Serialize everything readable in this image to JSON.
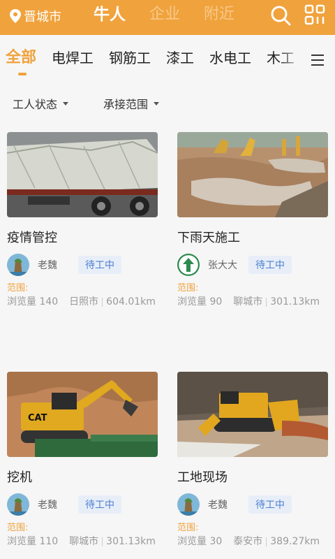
{
  "header": {
    "location": "晋城市",
    "tabs": [
      {
        "label": "牛人",
        "active": true
      },
      {
        "label": "企业",
        "active": false
      },
      {
        "label": "附近",
        "active": false
      }
    ],
    "accent_color": "#f0a23c"
  },
  "categories": [
    {
      "label": "全部",
      "active": true
    },
    {
      "label": "电焊工"
    },
    {
      "label": "钢筋工"
    },
    {
      "label": "漆工"
    },
    {
      "label": "水电工"
    },
    {
      "label": "木工"
    }
  ],
  "filters": [
    {
      "label": "工人状态"
    },
    {
      "label": "承接范围"
    }
  ],
  "cards": [
    {
      "title": "疫情管控",
      "user": "老魏",
      "status": "待工中",
      "range_label": "范围:",
      "views": "浏览量 140",
      "city": "日照市",
      "distance": "604.01km",
      "image": "truck",
      "avatar": "landscape-avatar"
    },
    {
      "title": "下雨天施工",
      "user": "张大大",
      "status": "待工中",
      "range_label": "范围:",
      "views": "浏览量 90",
      "city": "聊城市",
      "distance": "301.13km",
      "image": "rainy-site",
      "avatar": "green-arrow-avatar"
    },
    {
      "title": "挖机",
      "user": "老魏",
      "status": "待工中",
      "range_label": "范围:",
      "views": "浏览量 110",
      "city": "聊城市",
      "distance": "301.13km",
      "image": "excavator",
      "avatar": "landscape-avatar"
    },
    {
      "title": "工地现场",
      "user": "老魏",
      "status": "待工中",
      "range_label": "范围:",
      "views": "浏览量 30",
      "city": "泰安市",
      "distance": "389.27km",
      "image": "bulldozer",
      "avatar": "landscape-avatar"
    }
  ]
}
